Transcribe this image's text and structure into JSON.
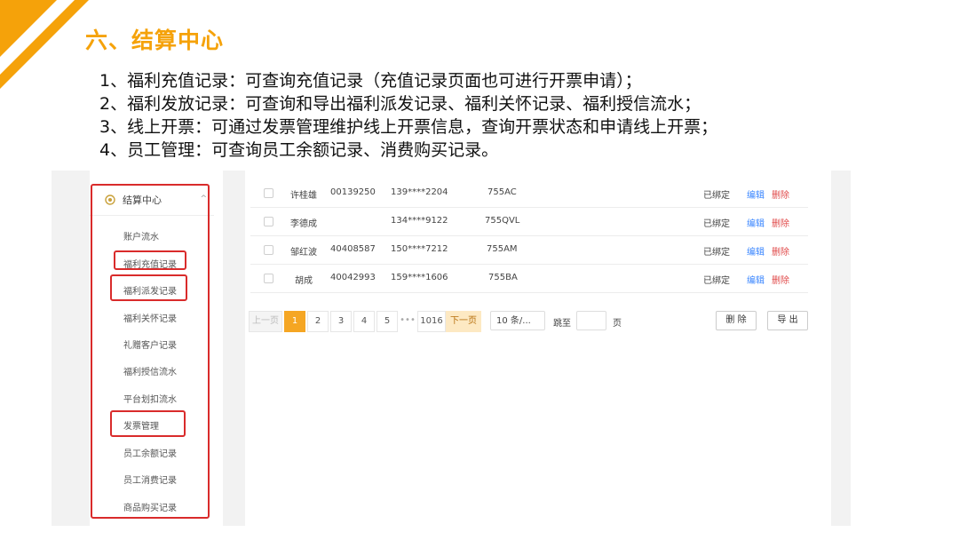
{
  "slide": {
    "title": "六、结算中心",
    "points": [
      "1、福利充值记录：可查询充值记录（充值记录页面也可进行开票申请）；",
      "2、福利发放记录：可查询和导出福利派发记录、福利关怀记录、福利授信流水；",
      "3、线上开票：可通过发票管理维护线上开票信息，查询开票状态和申请线上开票；",
      "4、员工管理：可查询员工余额记录、消费购买记录。"
    ],
    "accent_color": "#f5a20a"
  },
  "sidebar": {
    "header": "结算中心",
    "items": [
      "账户流水",
      "福利充值记录",
      "福利派发记录",
      "福利关怀记录",
      "礼赠客户记录",
      "福利授信流水",
      "平台划扣流水",
      "发票管理",
      "员工余额记录",
      "员工消费记录",
      "商品购买记录"
    ]
  },
  "table": {
    "rows": [
      {
        "name": "许桂雄",
        "id": "00139250",
        "phone": "139****2204",
        "code": "755AC",
        "status": "已绑定",
        "edit": "编辑",
        "delete": "删除"
      },
      {
        "name": "李德成",
        "id": "",
        "phone": "134****9122",
        "code": "755QVL",
        "status": "已绑定",
        "edit": "编辑",
        "delete": "删除"
      },
      {
        "name": "邹红波",
        "id": "40408587",
        "phone": "150****7212",
        "code": "755AM",
        "status": "已绑定",
        "edit": "编辑",
        "delete": "删除"
      },
      {
        "name": "胡成",
        "id": "40042993",
        "phone": "159****1606",
        "code": "755BA",
        "status": "已绑定",
        "edit": "编辑",
        "delete": "删除"
      }
    ]
  },
  "pagination": {
    "prev": "上一页",
    "pages": [
      "1",
      "2",
      "3",
      "4",
      "5"
    ],
    "ellipsis": "•••",
    "last": "1016",
    "next": "下一页",
    "page_size": "10 条/...",
    "jump_label": "跳至",
    "page_label": "页",
    "current": 1
  },
  "actions": {
    "delete": "删 除",
    "export": "导 出"
  }
}
